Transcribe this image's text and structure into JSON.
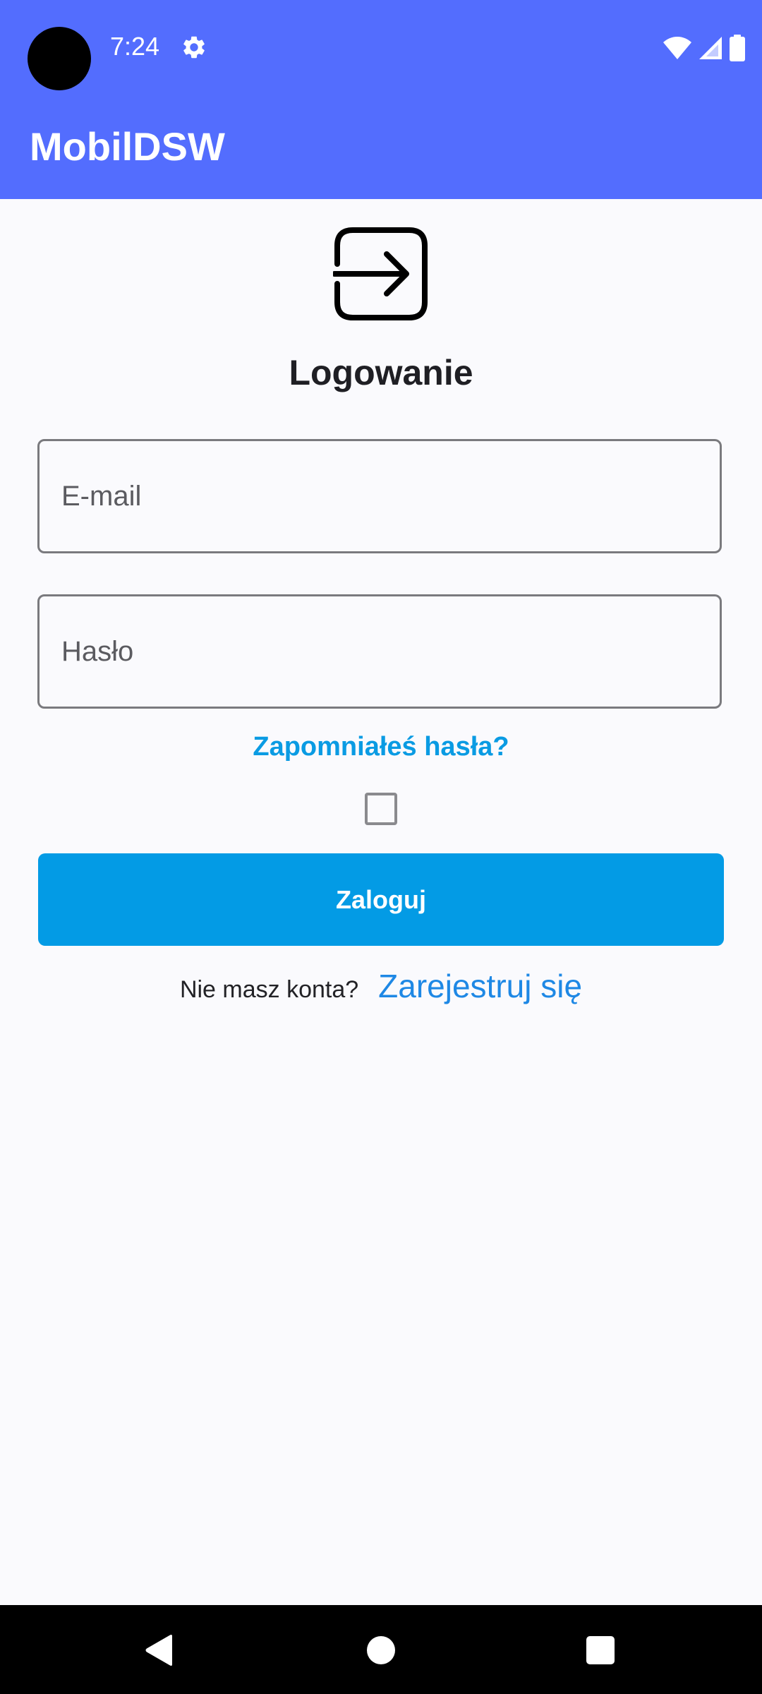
{
  "status_bar": {
    "time": "7:24",
    "icons": [
      "camera-cutout-icon",
      "gear-icon",
      "wifi-icon",
      "signal-icon",
      "battery-icon"
    ]
  },
  "app_bar": {
    "title": "MobilDSW",
    "background_color": "#536dfe"
  },
  "login": {
    "icon": "login-arrow-icon",
    "heading": "Logowanie",
    "email": {
      "placeholder": "E-mail",
      "value": ""
    },
    "password": {
      "placeholder": "Hasło",
      "value": ""
    },
    "forgot_password": "Zapomniałeś hasła?",
    "remember_checkbox_checked": false,
    "submit_label": "Zaloguj",
    "no_account_text": "Nie masz konta?",
    "register_link": "Zarejestruj się",
    "accent_color": "#039be5"
  },
  "nav_bar": {
    "icons": [
      "back-icon",
      "home-icon",
      "recents-icon"
    ]
  }
}
